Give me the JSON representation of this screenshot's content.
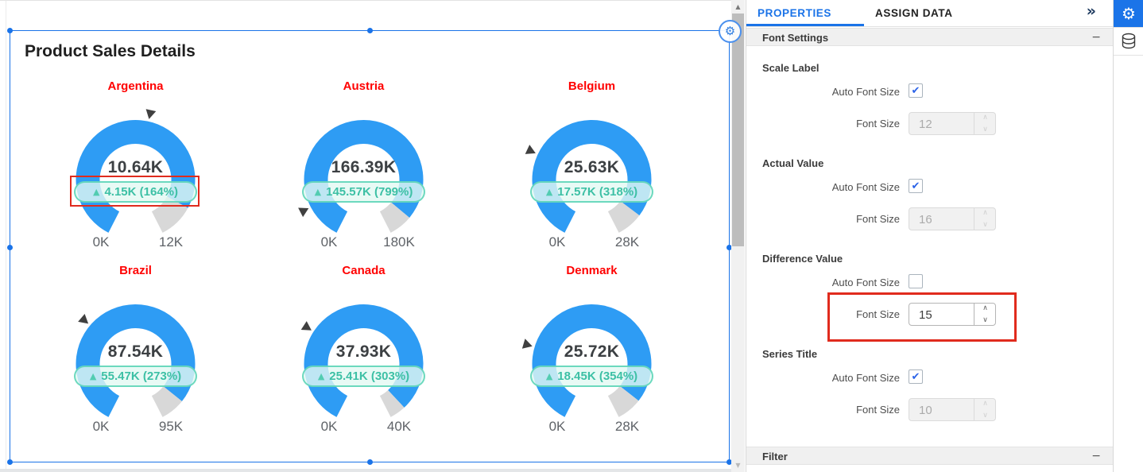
{
  "widget": {
    "title": "Product Sales Details"
  },
  "chart_data": [
    {
      "type": "gauge",
      "name": "Argentina",
      "actual": "10.64K",
      "difference": "4.15K",
      "percent": "164%",
      "min": "0K",
      "max": "12K",
      "actual_value": 10640,
      "difference_value": 4150,
      "scale_max": 12000,
      "value_fraction": 0.887,
      "marker_fraction": 0.541,
      "highlighted": true
    },
    {
      "type": "gauge",
      "name": "Austria",
      "actual": "166.39K",
      "difference": "145.57K",
      "percent": "799%",
      "min": "0K",
      "max": "180K",
      "actual_value": 166390,
      "difference_value": 145570,
      "scale_max": 180000,
      "value_fraction": 0.924,
      "marker_fraction": 0.116,
      "highlighted": false
    },
    {
      "type": "gauge",
      "name": "Belgium",
      "actual": "25.63K",
      "difference": "17.57K",
      "percent": "318%",
      "min": "0K",
      "max": "28K",
      "actual_value": 25630,
      "difference_value": 17570,
      "scale_max": 28000,
      "value_fraction": 0.915,
      "marker_fraction": 0.288,
      "highlighted": false
    },
    {
      "type": "gauge",
      "name": "Brazil",
      "actual": "87.54K",
      "difference": "55.47K",
      "percent": "273%",
      "min": "0K",
      "max": "95K",
      "actual_value": 87540,
      "difference_value": 55470,
      "scale_max": 95000,
      "value_fraction": 0.921,
      "marker_fraction": 0.338,
      "highlighted": false
    },
    {
      "type": "gauge",
      "name": "Canada",
      "actual": "37.93K",
      "difference": "25.41K",
      "percent": "303%",
      "min": "0K",
      "max": "40K",
      "actual_value": 37930,
      "difference_value": 25410,
      "scale_max": 40000,
      "value_fraction": 0.948,
      "marker_fraction": 0.313,
      "highlighted": false
    },
    {
      "type": "gauge",
      "name": "Denmark",
      "actual": "25.72K",
      "difference": "18.45K",
      "percent": "354%",
      "min": "0K",
      "max": "28K",
      "actual_value": 25720,
      "difference_value": 18450,
      "scale_max": 28000,
      "value_fraction": 0.919,
      "marker_fraction": 0.26,
      "highlighted": false
    }
  ],
  "gauge_layout": {
    "start_angle": 207,
    "sweep": 306
  },
  "colors": {
    "gauge_blue": "#2E9CF4",
    "gauge_gray": "#D8D8D8",
    "marker": "#404040",
    "series_title": "#FF0000",
    "highlight_red": "#E02B1D",
    "selection_blue": "#1A73E8",
    "pill_text": "#3DC0A5"
  },
  "panel": {
    "tabs": [
      "PROPERTIES",
      "ASSIGN DATA"
    ],
    "collapse_icon": "»",
    "font_settings_title": "Font Settings",
    "filter_title": "Filter",
    "minus_icon": "−",
    "labels": {
      "auto_font_size": "Auto Font Size",
      "font_size": "Font Size"
    },
    "groups": [
      {
        "label": "Scale Label",
        "auto_checked": true,
        "font_size": "12",
        "enabled": false,
        "highlighted": false
      },
      {
        "label": "Actual Value",
        "auto_checked": true,
        "font_size": "16",
        "enabled": false,
        "highlighted": false
      },
      {
        "label": "Difference Value",
        "auto_checked": false,
        "font_size": "15",
        "enabled": true,
        "highlighted": true
      },
      {
        "label": "Series Title",
        "auto_checked": true,
        "font_size": "10",
        "enabled": false,
        "highlighted": false
      }
    ]
  },
  "scrollbar": {
    "up_icon": "▲",
    "down_icon": "▼"
  },
  "toolbar": {
    "gear_icon": "⚙",
    "widget_gear_icon": "⚙",
    "check_icon": "✔",
    "spin_up": "∧",
    "spin_down": "∨",
    "pill_arrow": "▲"
  }
}
